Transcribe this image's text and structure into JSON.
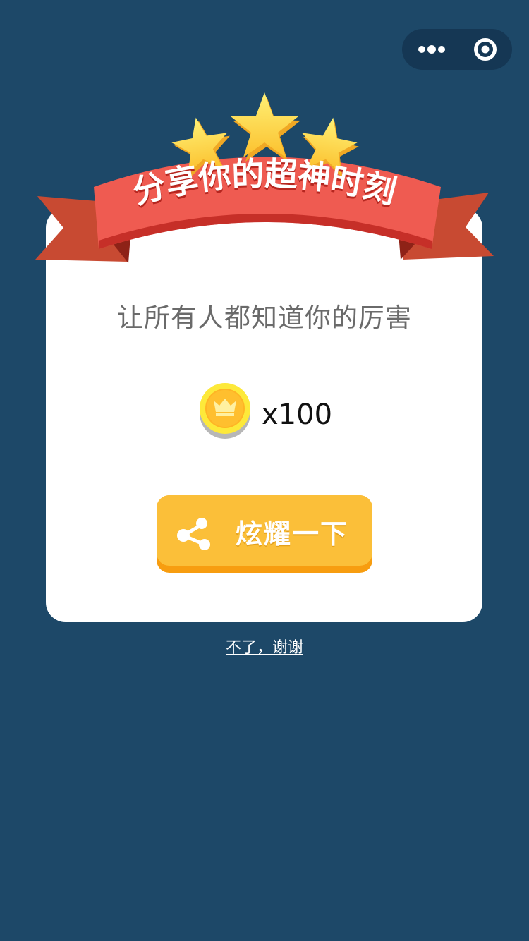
{
  "nav": {
    "more_icon": "more-dots-icon",
    "close_icon": "target-circle-icon"
  },
  "banner": {
    "title": "分享你的超神时刻",
    "star_count": 3,
    "ribbon_color": "#e8524a",
    "star_color": "#fdd835"
  },
  "modal": {
    "subtitle": "让所有人都知道你的厉害",
    "reward": {
      "icon": "crown-coin-icon",
      "amount": "x100"
    },
    "share_button": {
      "icon": "share-icon",
      "label": "炫耀一下"
    },
    "decline_link": "不了，谢谢"
  },
  "colors": {
    "background": "#1d4868",
    "card": "#ffffff",
    "button": "#fbbf39",
    "button_shadow": "#f79d10"
  }
}
